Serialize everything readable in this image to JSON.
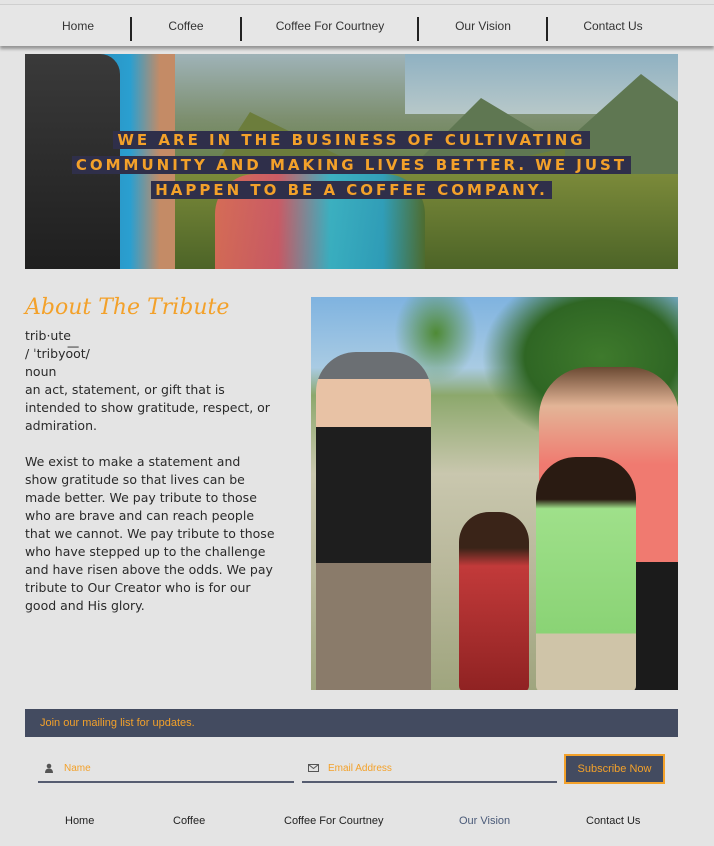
{
  "nav": {
    "items": [
      {
        "label": "Home"
      },
      {
        "label": "Coffee"
      },
      {
        "label": "Coffee For Courtney"
      },
      {
        "label": "Our Vision"
      },
      {
        "label": "Contact Us"
      }
    ]
  },
  "hero": {
    "headline_lines": [
      "WE ARE IN THE BUSINESS OF CULTIVATING",
      "COMMUNITY AND MAKING LIVES BETTER. WE JUST",
      "HAPPEN TO BE A COFFEE COMPANY."
    ]
  },
  "about": {
    "title": "About The Tribute",
    "word": "trib·ute",
    "pronunciation": "/ ˈtribyo͞ot/",
    "part_of_speech": "noun",
    "definition": "an act, statement, or gift that is intended to show gratitude, respect, or admiration.",
    "paragraph": "We exist to make a statement and show gratitude so that lives can be made better. We pay tribute to those who are brave and can reach people that we cannot. We pay tribute to those who have stepped up to the challenge and have risen above the odds. We pay tribute to Our Creator who is for our good and His glory."
  },
  "mailing": {
    "banner": "Join our mailing list for updates.",
    "name_placeholder": "Name",
    "email_placeholder": "Email Address",
    "subscribe_label": "Subscribe Now",
    "name_icon": "person-icon",
    "email_icon": "envelope-icon"
  },
  "footer": {
    "items": [
      {
        "label": "Home"
      },
      {
        "label": "Coffee"
      },
      {
        "label": "Coffee For Courtney"
      },
      {
        "label": "Our Vision"
      },
      {
        "label": "Contact Us"
      }
    ]
  },
  "colors": {
    "accent": "#f3a12a",
    "dark_navy": "#434b60",
    "background": "#e4e4e4"
  }
}
